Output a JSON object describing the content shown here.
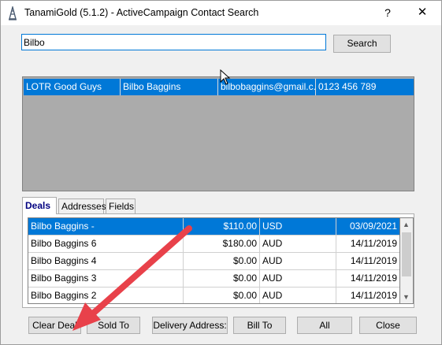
{
  "window": {
    "title": "TanamiGold (5.1.2) - ActiveCampaign Contact Search",
    "help_label": "?",
    "close_label": "✕"
  },
  "search": {
    "value": "Bilbo",
    "button_label": "Search"
  },
  "results": {
    "rows": [
      {
        "group": "LOTR Good Guys",
        "name": "Bilbo Baggins",
        "email": "bilbobaggins@gmail.c...",
        "phone": "0123 456 789"
      }
    ]
  },
  "tabs": [
    {
      "label": "Deals",
      "active": true
    },
    {
      "label": "Addresses",
      "active": false
    },
    {
      "label": "Fields",
      "active": false
    }
  ],
  "deals": {
    "rows": [
      {
        "name": "Bilbo Baggins -",
        "amount": "$110.00",
        "currency": "USD",
        "date": "03/09/2021",
        "selected": true
      },
      {
        "name": "Bilbo Baggins 6",
        "amount": "$180.00",
        "currency": "AUD",
        "date": "14/11/2019",
        "selected": false
      },
      {
        "name": "Bilbo Baggins 4",
        "amount": "$0.00",
        "currency": "AUD",
        "date": "14/11/2019",
        "selected": false
      },
      {
        "name": "Bilbo Baggins 3",
        "amount": "$0.00",
        "currency": "AUD",
        "date": "14/11/2019",
        "selected": false
      },
      {
        "name": "Bilbo Baggins 2",
        "amount": "$0.00",
        "currency": "AUD",
        "date": "14/11/2019",
        "selected": false
      }
    ]
  },
  "buttons": {
    "clear_deal": "Clear Deal",
    "sold_to": "Sold To",
    "delivery_address": "Delivery Address:",
    "bill_to": "Bill To",
    "all": "All",
    "close": "Close"
  },
  "colors": {
    "selection": "#0078d7",
    "annotation_arrow": "#e8414a"
  }
}
